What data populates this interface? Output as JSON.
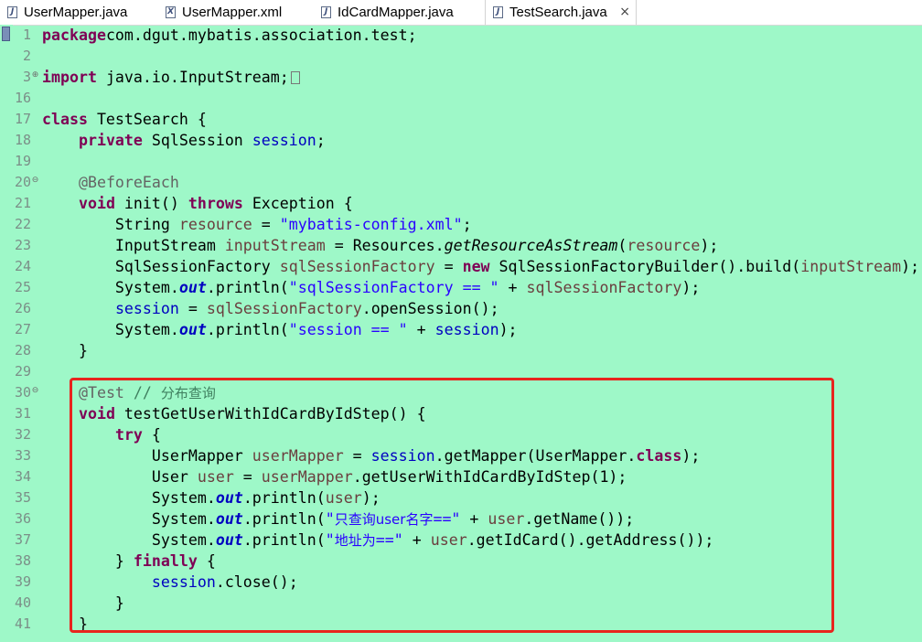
{
  "tabs": [
    {
      "label": "UserMapper.java",
      "icon": "java-file-icon"
    },
    {
      "label": "UserMapper.xml",
      "icon": "xml-file-icon"
    },
    {
      "label": "IdCardMapper.java",
      "icon": "java-file-icon"
    },
    {
      "label": "TestSearch.java",
      "icon": "java-file-icon",
      "active": true,
      "close": "×"
    }
  ],
  "lines": [
    {
      "n": "1",
      "t": [
        [
          "kw",
          "package"
        ],
        [
          "",
          "com.dgut.mybatis.association.test;"
        ]
      ]
    },
    {
      "n": "2",
      "t": []
    },
    {
      "n": "3",
      "fold": "+",
      "t": [
        [
          "kw",
          "import"
        ],
        [
          "",
          " java.io.InputStream;"
        ],
        [
          "box",
          ""
        ]
      ]
    },
    {
      "n": "16",
      "t": []
    },
    {
      "n": "17",
      "t": [
        [
          "kw",
          "class"
        ],
        [
          "",
          " TestSearch {"
        ]
      ]
    },
    {
      "n": "18",
      "t": [
        [
          "",
          "    "
        ],
        [
          "kw",
          "private"
        ],
        [
          "",
          " SqlSession "
        ],
        [
          "fld",
          "session"
        ],
        [
          "",
          ";"
        ]
      ]
    },
    {
      "n": "19",
      "t": []
    },
    {
      "n": "20",
      "fold": "-",
      "t": [
        [
          "",
          "    "
        ],
        [
          "ann",
          "@BeforeEach"
        ]
      ]
    },
    {
      "n": "21",
      "t": [
        [
          "",
          "    "
        ],
        [
          "kw",
          "void"
        ],
        [
          "",
          " init() "
        ],
        [
          "kw",
          "throws"
        ],
        [
          "",
          " Exception {"
        ]
      ]
    },
    {
      "n": "22",
      "t": [
        [
          "",
          "        String "
        ],
        [
          "var",
          "resource"
        ],
        [
          "",
          " = "
        ],
        [
          "str",
          "\"mybatis-config.xml\""
        ],
        [
          "",
          ";"
        ]
      ]
    },
    {
      "n": "23",
      "t": [
        [
          "",
          "        InputStream "
        ],
        [
          "var",
          "inputStream"
        ],
        [
          "",
          " = Resources."
        ],
        [
          "ital",
          "getResourceAsStream"
        ],
        [
          "",
          "("
        ],
        [
          "var",
          "resource"
        ],
        [
          "",
          ");"
        ]
      ]
    },
    {
      "n": "24",
      "t": [
        [
          "",
          "        SqlSessionFactory "
        ],
        [
          "var",
          "sqlSessionFactory"
        ],
        [
          "",
          " = "
        ],
        [
          "kw",
          "new"
        ],
        [
          "",
          " SqlSessionFactoryBuilder().build("
        ],
        [
          "var",
          "inputStream"
        ],
        [
          "",
          ");"
        ]
      ]
    },
    {
      "n": "25",
      "t": [
        [
          "",
          "        System."
        ],
        [
          "stat",
          "out"
        ],
        [
          "",
          ".println("
        ],
        [
          "str",
          "\"sqlSessionFactory == \""
        ],
        [
          "",
          " + "
        ],
        [
          "var",
          "sqlSessionFactory"
        ],
        [
          "",
          ");"
        ]
      ]
    },
    {
      "n": "26",
      "t": [
        [
          "",
          "        "
        ],
        [
          "fld",
          "session"
        ],
        [
          "",
          " = "
        ],
        [
          "var",
          "sqlSessionFactory"
        ],
        [
          "",
          ".openSession();"
        ]
      ]
    },
    {
      "n": "27",
      "t": [
        [
          "",
          "        System."
        ],
        [
          "stat",
          "out"
        ],
        [
          "",
          ".println("
        ],
        [
          "str",
          "\"session == \""
        ],
        [
          "",
          " + "
        ],
        [
          "fld",
          "session"
        ],
        [
          "",
          ");"
        ]
      ]
    },
    {
      "n": "28",
      "t": [
        [
          "",
          "    }"
        ]
      ]
    },
    {
      "n": "29",
      "t": []
    },
    {
      "n": "30",
      "fold": "-",
      "t": [
        [
          "",
          "    "
        ],
        [
          "ann",
          "@Test"
        ],
        [
          "",
          " "
        ],
        [
          "cmt",
          "// "
        ],
        [
          "cmtcjk",
          "分布查询"
        ]
      ]
    },
    {
      "n": "31",
      "t": [
        [
          "",
          "    "
        ],
        [
          "kw",
          "void"
        ],
        [
          "",
          " testGetUserWithIdCardByIdStep() {"
        ]
      ]
    },
    {
      "n": "32",
      "t": [
        [
          "",
          "        "
        ],
        [
          "kw",
          "try"
        ],
        [
          "",
          " {"
        ]
      ]
    },
    {
      "n": "33",
      "t": [
        [
          "",
          "            UserMapper "
        ],
        [
          "var",
          "userMapper"
        ],
        [
          "",
          " = "
        ],
        [
          "fld",
          "session"
        ],
        [
          "",
          ".getMapper(UserMapper."
        ],
        [
          "kw",
          "class"
        ],
        [
          "",
          ");"
        ]
      ]
    },
    {
      "n": "34",
      "t": [
        [
          "",
          "            User "
        ],
        [
          "var",
          "user"
        ],
        [
          "",
          " = "
        ],
        [
          "var",
          "userMapper"
        ],
        [
          "",
          ".getUserWithIdCardByIdStep(1);"
        ]
      ]
    },
    {
      "n": "35",
      "t": [
        [
          "",
          "            System."
        ],
        [
          "stat",
          "out"
        ],
        [
          "",
          ".println("
        ],
        [
          "var",
          "user"
        ],
        [
          "",
          ");"
        ]
      ]
    },
    {
      "n": "36",
      "t": [
        [
          "",
          "            System."
        ],
        [
          "stat",
          "out"
        ],
        [
          "",
          ".println("
        ],
        [
          "str",
          "\""
        ],
        [
          "strcjk",
          "只查询user名字"
        ],
        [
          "str",
          "==\""
        ],
        [
          "",
          " + "
        ],
        [
          "var",
          "user"
        ],
        [
          "",
          ".getName());"
        ]
      ]
    },
    {
      "n": "37",
      "t": [
        [
          "",
          "            System."
        ],
        [
          "stat",
          "out"
        ],
        [
          "",
          ".println("
        ],
        [
          "str",
          "\""
        ],
        [
          "strcjk",
          "地址为"
        ],
        [
          "str",
          "==\""
        ],
        [
          "",
          " + "
        ],
        [
          "var",
          "user"
        ],
        [
          "",
          ".getIdCard().getAddress());"
        ]
      ]
    },
    {
      "n": "38",
      "t": [
        [
          "",
          "        } "
        ],
        [
          "kw",
          "finally"
        ],
        [
          "",
          " {"
        ]
      ]
    },
    {
      "n": "39",
      "t": [
        [
          "",
          "            "
        ],
        [
          "fld",
          "session"
        ],
        [
          "",
          ".close();"
        ]
      ]
    },
    {
      "n": "40",
      "t": [
        [
          "",
          "        }"
        ]
      ]
    },
    {
      "n": "41",
      "t": [
        [
          "",
          "    }"
        ]
      ]
    }
  ]
}
